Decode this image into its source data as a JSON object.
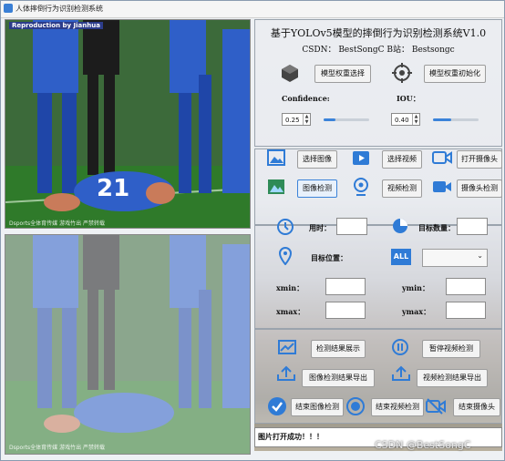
{
  "window": {
    "title": "人体摔倒行为识别检测系统"
  },
  "image_panels": {
    "overlay_title": "Reproduction by Jianhua",
    "watermark": "Dsports全体育传媒 游戏竹出 严禁转载",
    "jersey_number": "21"
  },
  "header": {
    "title": "基于YOLOv5模型的摔倒行为识别检测系统V1.0",
    "subtitle": "CSDN：  BestSongC   B站：  Bestsongc"
  },
  "model": {
    "select_label": "模型权重选择",
    "init_label": "模型权重初始化"
  },
  "params": {
    "confidence_label": "Confidence:",
    "confidence_value": "0.25",
    "confidence_fraction": 0.25,
    "iou_label": "IOU：",
    "iou_value": "0.40",
    "iou_fraction": 0.4
  },
  "actions": {
    "select_image": "选择图像",
    "select_video": "选择视频",
    "open_camera": "打开摄像头",
    "detect_image": "图像检测",
    "detect_video": "视频检测",
    "detect_camera": "摄像头检测"
  },
  "results": {
    "time_label": "用时：",
    "count_label": "目标数量：",
    "position_label": "目标位置：",
    "xmin_label": "xmin：",
    "ymin_label": "ymin：",
    "xmax_label": "xmax：",
    "ymax_label": "ymax：",
    "all_badge": "ALL"
  },
  "controls": {
    "show_results": "检测结果展示",
    "pause_video": "暂停视频检测",
    "export_image": "图像检测结果导出",
    "export_video": "视频检测结果导出",
    "end_image": "结束图像检测",
    "end_video": "结束视频检测",
    "end_camera": "结束摄像头"
  },
  "status_text": "图片打开成功！！！",
  "footer_watermark": "CSDN @BestSongC",
  "colors": {
    "accent": "#3b83d9",
    "jersey": "#2f5fc8",
    "pitch": "#2f7a2a"
  }
}
